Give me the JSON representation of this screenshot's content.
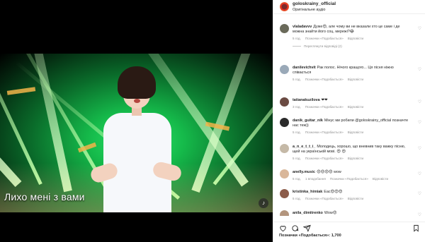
{
  "video": {
    "caption": "Лихо мені з вами"
  },
  "post": {
    "username": "goloskrainy_official",
    "subtitle": "Оригінальне аудіо"
  },
  "comment_actions": {
    "likes_label": "Позначки «Подобається»",
    "reply_label": "Відповісти"
  },
  "comments": [
    {
      "user": "vlaladavvv",
      "text": "Дуже😍, але чому ви не вказали хто це саме і де можна знайти його соц. мережі?😂",
      "time": "5 год.",
      "likes": "",
      "replies": "Переглянути відповіді (2)",
      "avatar": "#6a6a5a"
    },
    {
      "user": "danilevichvit",
      "text": "Рак полос. Нічого кращого... Ця пісня ніжно співається",
      "time": "5 год.",
      "likes": "",
      "replies": "",
      "avatar": "#9aa9b8"
    },
    {
      "user": "tatianakuzilova",
      "text": "❤❤",
      "time": "3 год.",
      "likes": "",
      "replies": "",
      "avatar": "#6b4b43"
    },
    {
      "user": "danik_guitar_nik",
      "text": "Мінус ми робили @goloskrainy_official позначте нас теж))",
      "time": "5 год.",
      "likes": "",
      "replies": "",
      "avatar": "#2b2b2b"
    },
    {
      "user": "a_n_e_t_t_i_",
      "text": "Молодець, хорошо, що вневнив таку важку пісню, щей на українській мові. 😍 😍",
      "time": "5 год.",
      "likes": "",
      "replies": "",
      "avatar": "#c5b9a7"
    },
    {
      "user": "anelly.music",
      "text": "😍😍😍😍 wow",
      "time": "5 год.",
      "likes": "1 вподобання",
      "replies": "",
      "avatar": "#d9b79a"
    },
    {
      "user": "kristinka_himiak",
      "text": "Еас😍😍😍",
      "time": "5 год.",
      "likes": "",
      "replies": "",
      "avatar": "#8c5c4a"
    },
    {
      "user": "anila_dimitrenko",
      "text": "Wow😍",
      "time": "",
      "likes": "",
      "replies": "",
      "avatar": "#b3957d"
    }
  ],
  "footer": {
    "likes_text": "Позначки «Подобається»: 1,700"
  },
  "icons": [
    "heart-icon",
    "comment-icon",
    "share-icon",
    "bookmark-icon",
    "audio-icon"
  ]
}
